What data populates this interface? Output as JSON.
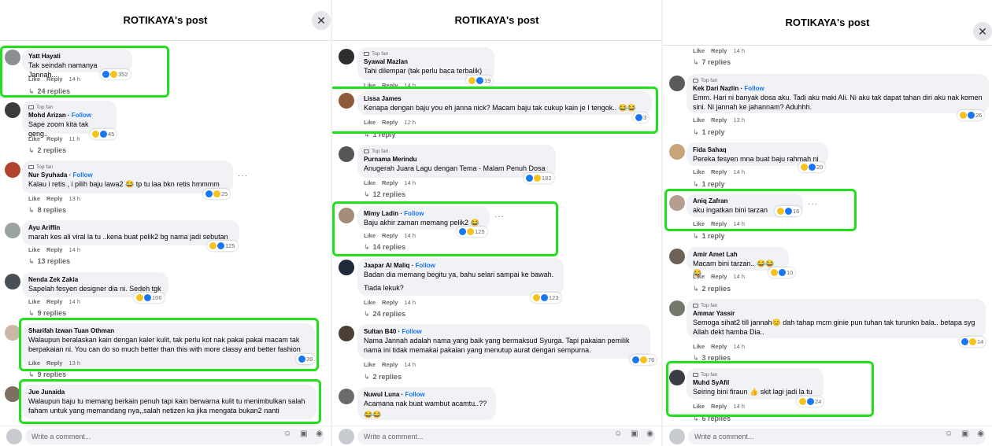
{
  "colors": {
    "highlight": "#22e01d",
    "link": "#1877f2",
    "bubble": "#f0f2f5",
    "muted": "#65676b"
  },
  "icons": {
    "close": "close-icon",
    "reply_arrow": "reply-arrow-icon",
    "like": "like-reaction-icon",
    "haha": "haha-reaction-icon",
    "love": "love-reaction-icon",
    "emoji": "emoji-icon",
    "gif": "gif-icon",
    "sticker": "sticker-icon"
  },
  "panels": [
    {
      "title": "ROTIKAYA's post",
      "write_placeholder": "Write a comment...",
      "comments": [
        {
          "name": "Yatt Hayati",
          "text": "Tak seindah namanya Jannah...",
          "like": "Like",
          "reply": "Reply",
          "time": "14 h",
          "count": "352",
          "replies": "24 replies"
        },
        {
          "badge": "Top fan",
          "name": "Mohd Arizan",
          "follow": "Follow",
          "text": "Sape zoom kita tak geng..",
          "like": "Like",
          "reply": "Reply",
          "time": "11 h",
          "count": "45",
          "replies": "2 replies"
        },
        {
          "badge": "Top fan",
          "name": "Nur Syuhada",
          "follow": "Follow",
          "text": "Kalau i retis , i pilih baju lawa2 😂 tp tu laa bkn retis hmmmm",
          "like": "Like",
          "reply": "Reply",
          "time": "13 h",
          "count": "25",
          "replies": "8 replies"
        },
        {
          "name": "Ayu Ariffin",
          "text": "marah kes ali viral la tu ..kena buat pelik2 bg nama jadi sebutan",
          "like": "Like",
          "reply": "Reply",
          "time": "14 h",
          "count": "125",
          "replies": "13 replies"
        },
        {
          "name": "Nenda Zek Zakia",
          "text": "Sapelah fesyen designer dia ni. Sedeh tgk",
          "like": "Like",
          "reply": "Reply",
          "time": "14 h",
          "count": "106",
          "replies": "9 replies"
        },
        {
          "name": "Sharifah Izwan Tuan Othman",
          "text": "Walaupun beralaskan kain dengan kaler kulit, tak perlu kot nak pakai pakai macam tak berpakaian ni. You can do so much better than this with more classy and better fashion",
          "like": "Like",
          "reply": "Reply",
          "time": "13 h",
          "count": "39",
          "replies": "9 replies"
        },
        {
          "name": "Jue Junaida",
          "text": "Walaupun baju tu memang berkain penuh tapi kain berwarna kulit tu menimbulkan salah faham untuk yang memandang nya,,salah netizen ka jika mengata bukan2 nanti"
        }
      ]
    },
    {
      "title": "ROTIKAYA's post",
      "write_placeholder": "Write a comment...",
      "comments": [
        {
          "badge": "Top fan",
          "name": "Syawal Mazlan",
          "text": "Tahi dilempar (tak perlu baca terbalik)",
          "like": "Like",
          "reply": "Reply",
          "time": "14 h",
          "count": "19"
        },
        {
          "name": "Lissa James",
          "text": "Kenapa dengan baju you eh janna nick? Macam baju tak cukup kain je I tengok.. 😂😂",
          "like": "Like",
          "reply": "Reply",
          "time": "12 h",
          "count": "3",
          "replies": "1 reply"
        },
        {
          "badge": "Top fan",
          "name": "Purnama Merindu",
          "text": "Anugerah Juara Lagu dengan Tema - Malam Penuh Dosa",
          "like": "Like",
          "reply": "Reply",
          "time": "14 h",
          "count": "182",
          "replies": "12 replies"
        },
        {
          "name": "Mimy Ladin",
          "follow": "Follow",
          "text": "Baju akhir zaman memang pelik2 😂",
          "like": "Like",
          "reply": "Reply",
          "time": "14 h",
          "count": "125",
          "replies": "14 replies"
        },
        {
          "name": "Jaapar Al Maliq",
          "follow": "Follow",
          "text": "Badan dia memang begitu ya, bahu selari sampai ke bawah.",
          "text2": "Tiada lekuk?",
          "like": "Like",
          "reply": "Reply",
          "time": "14 h",
          "count": "123",
          "replies": "24 replies"
        },
        {
          "name": "Sultan B40",
          "follow": "Follow",
          "text": "Nama Jannah adalah nama yang baik yang bermaksud Syurga. Tapi pakaian pemilik nama ini tidak memakai pakaian yang menutup aurat dengan sempurna.",
          "like": "Like",
          "reply": "Reply",
          "time": "14 h",
          "count": "76",
          "replies": "2 replies"
        },
        {
          "name": "Nuwul Luna",
          "follow": "Follow",
          "text": "Acamana nak buat wambut acamtu..??",
          "text2": "😂😂"
        }
      ]
    },
    {
      "title": "ROTIKAYA's post",
      "write_placeholder": "Write a comment...",
      "comments": [
        {
          "like": "Like",
          "reply": "Reply",
          "time": "14 h",
          "replies": "7 replies"
        },
        {
          "badge": "Top fan",
          "name": "Kek Dari Nazlin",
          "follow": "Follow",
          "text": "Emm. Hari ni banyak dosa aku. Tadi aku maki Ali. Ni aku tak dapat tahan diri aku nak komen sini. Ni jannah ke jahannam? Aduhhh.",
          "like": "Like",
          "reply": "Reply",
          "time": "13 h",
          "count": "26",
          "replies": "1 reply"
        },
        {
          "name": "Fida Sahaq",
          "text": "Pereka fesyen mna buat baju rahmah ni",
          "like": "Like",
          "reply": "Reply",
          "time": "14 h",
          "count": "20",
          "replies": "1 reply"
        },
        {
          "name": "Aniq Zafran",
          "text": "aku ingatkan bini tarzan",
          "like": "Like",
          "reply": "Reply",
          "time": "14 h",
          "count": "16",
          "replies": "1 reply"
        },
        {
          "name": "Amir Amet Lah",
          "text": "Macam bini tarzan.. 😂😂😂",
          "like": "Like",
          "reply": "Reply",
          "time": "14 h",
          "count": "10",
          "replies": "2 replies"
        },
        {
          "badge": "Top fan",
          "name": "Ammar Yassir",
          "text": "Semoga sihat2 till jannah😊 dah tahap mcm ginie pun tuhan tak turunkn bala.. betapa syg Allah dekt hamba Dia..",
          "like": "Like",
          "reply": "Reply",
          "time": "14 h",
          "count": "14",
          "replies": "3 replies"
        },
        {
          "badge": "Top fan",
          "name": "Muhd SyAfil",
          "text": "Seiring bini firaun 👍 skit lagi jadi la tu",
          "like": "Like",
          "reply": "Reply",
          "time": "14 h",
          "count": "24",
          "replies": "6 replies"
        }
      ]
    }
  ]
}
